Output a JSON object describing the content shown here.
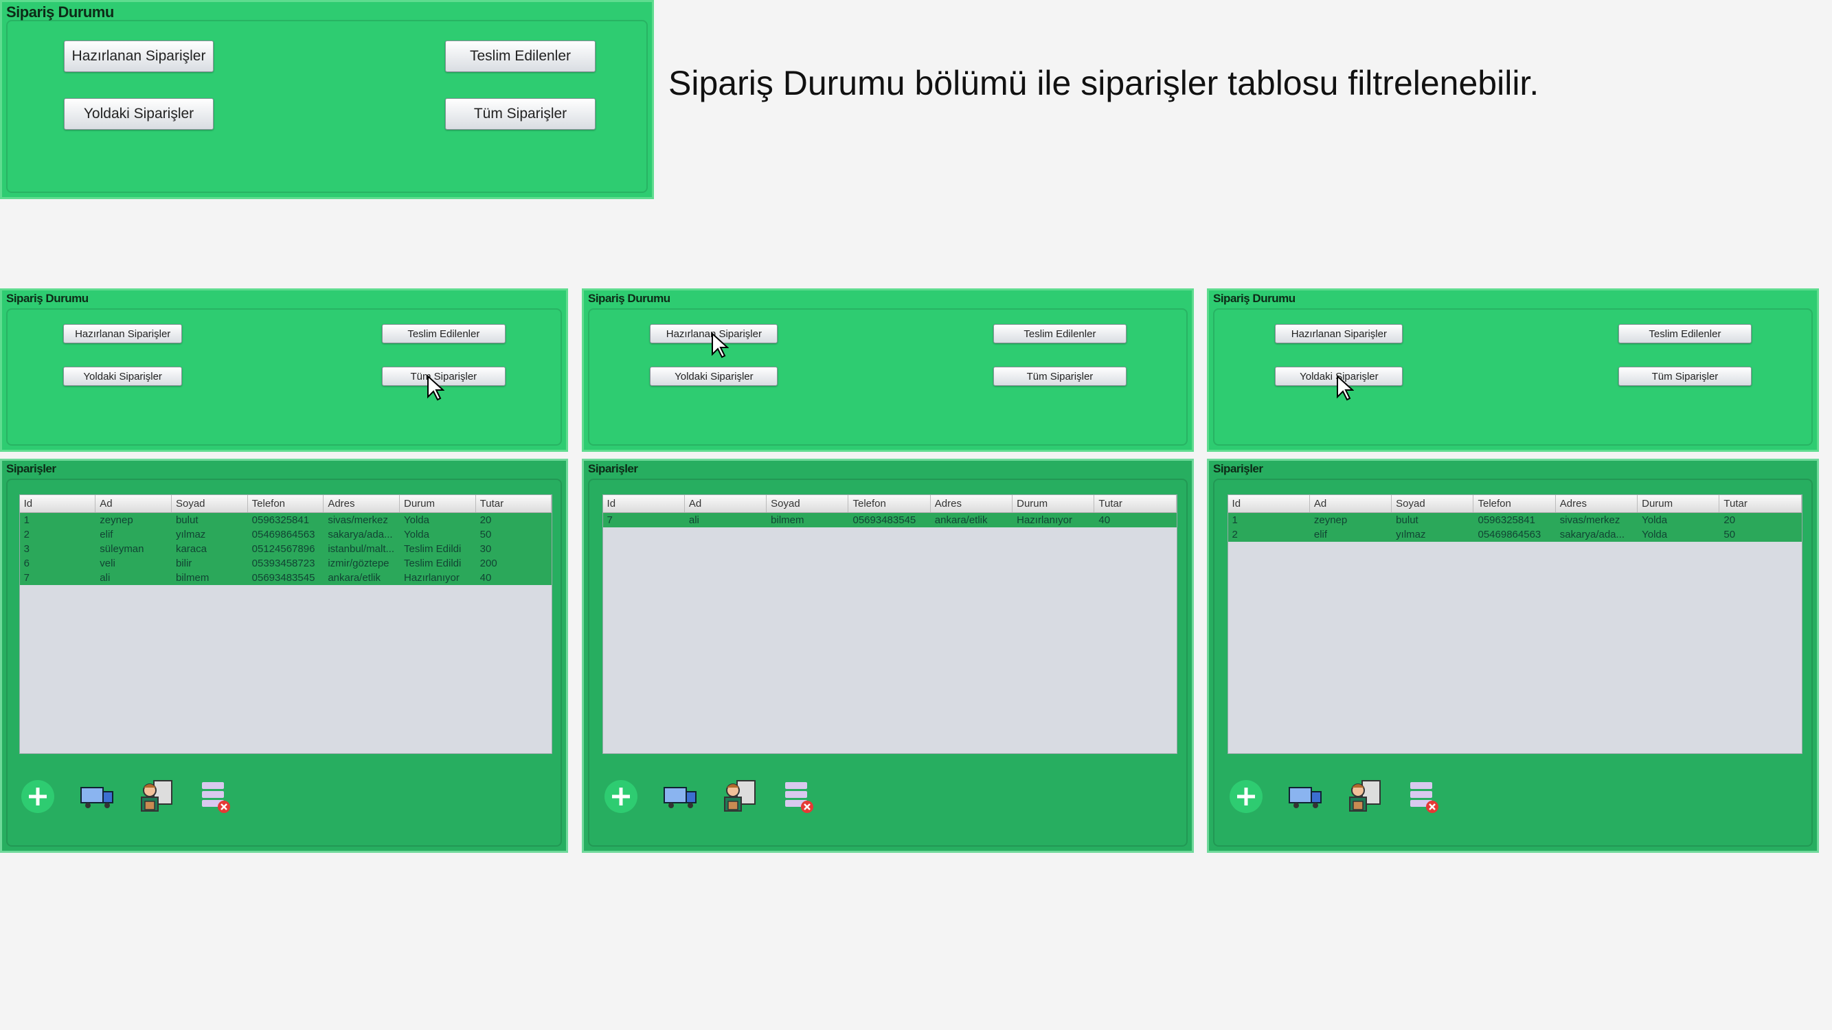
{
  "caption": "Sipariş Durumu bölümü ile siparişler tablosu filtrelenebilir.",
  "status_title": "Sipariş Durumu",
  "orders_title": "Siparişler",
  "buttons": {
    "preparing": "Hazırlanan Siparişler",
    "delivered": "Teslim Edilenler",
    "on_the_way": "Yoldaki Siparişler",
    "all": "Tüm Siparişler"
  },
  "columns": [
    "Id",
    "Ad",
    "Soyad",
    "Telefon",
    "Adres",
    "Durum",
    "Tutar"
  ],
  "icons": [
    "add-icon",
    "delivery-truck-icon",
    "courier-icon",
    "delete-database-icon"
  ],
  "colors": {
    "status_panel": "#2ecc71",
    "orders_panel": "#27ae60",
    "selected_row": "#2ba85a"
  },
  "screens": [
    {
      "clicked": "all",
      "rows": [
        [
          "1",
          "zeynep",
          "bulut",
          "0596325841",
          "sivas/merkez",
          "Yolda",
          "20"
        ],
        [
          "2",
          "elif",
          "yılmaz",
          "05469864563",
          "sakarya/ada...",
          "Yolda",
          "50"
        ],
        [
          "3",
          "süleyman",
          "karaca",
          "05124567896",
          "istanbul/malt...",
          "Teslim Edildi",
          "30"
        ],
        [
          "6",
          "veli",
          "bilir",
          "05393458723",
          "izmir/göztepe",
          "Teslim Edildi",
          "200"
        ],
        [
          "7",
          "ali",
          "bilmem",
          "05693483545",
          "ankara/etlik",
          "Hazırlanıyor",
          "40"
        ]
      ]
    },
    {
      "clicked": "preparing",
      "rows": [
        [
          "7",
          "ali",
          "bilmem",
          "05693483545",
          "ankara/etlik",
          "Hazırlanıyor",
          "40"
        ]
      ]
    },
    {
      "clicked": "on_the_way",
      "rows": [
        [
          "1",
          "zeynep",
          "bulut",
          "0596325841",
          "sivas/merkez",
          "Yolda",
          "20"
        ],
        [
          "2",
          "elif",
          "yılmaz",
          "05469864563",
          "sakarya/ada...",
          "Yolda",
          "50"
        ]
      ]
    }
  ]
}
